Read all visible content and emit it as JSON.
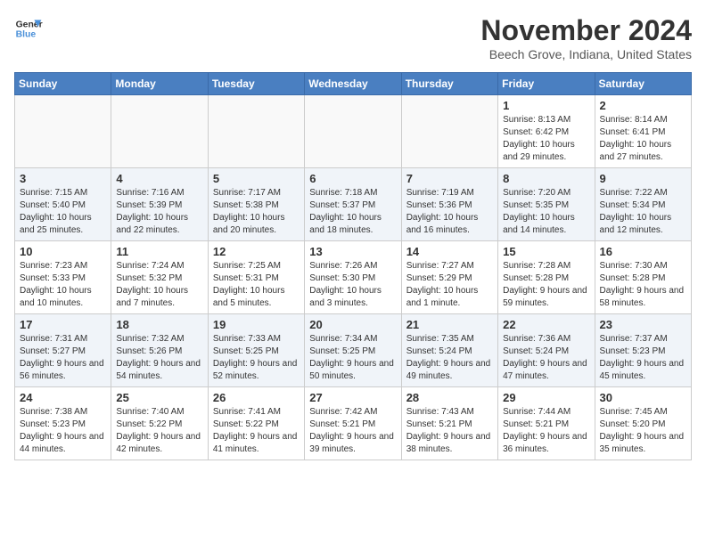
{
  "header": {
    "logo_line1": "General",
    "logo_line2": "Blue",
    "month": "November 2024",
    "location": "Beech Grove, Indiana, United States"
  },
  "weekdays": [
    "Sunday",
    "Monday",
    "Tuesday",
    "Wednesday",
    "Thursday",
    "Friday",
    "Saturday"
  ],
  "weeks": [
    [
      {
        "day": "",
        "info": ""
      },
      {
        "day": "",
        "info": ""
      },
      {
        "day": "",
        "info": ""
      },
      {
        "day": "",
        "info": ""
      },
      {
        "day": "",
        "info": ""
      },
      {
        "day": "1",
        "info": "Sunrise: 8:13 AM\nSunset: 6:42 PM\nDaylight: 10 hours and 29 minutes."
      },
      {
        "day": "2",
        "info": "Sunrise: 8:14 AM\nSunset: 6:41 PM\nDaylight: 10 hours and 27 minutes."
      }
    ],
    [
      {
        "day": "3",
        "info": "Sunrise: 7:15 AM\nSunset: 5:40 PM\nDaylight: 10 hours and 25 minutes."
      },
      {
        "day": "4",
        "info": "Sunrise: 7:16 AM\nSunset: 5:39 PM\nDaylight: 10 hours and 22 minutes."
      },
      {
        "day": "5",
        "info": "Sunrise: 7:17 AM\nSunset: 5:38 PM\nDaylight: 10 hours and 20 minutes."
      },
      {
        "day": "6",
        "info": "Sunrise: 7:18 AM\nSunset: 5:37 PM\nDaylight: 10 hours and 18 minutes."
      },
      {
        "day": "7",
        "info": "Sunrise: 7:19 AM\nSunset: 5:36 PM\nDaylight: 10 hours and 16 minutes."
      },
      {
        "day": "8",
        "info": "Sunrise: 7:20 AM\nSunset: 5:35 PM\nDaylight: 10 hours and 14 minutes."
      },
      {
        "day": "9",
        "info": "Sunrise: 7:22 AM\nSunset: 5:34 PM\nDaylight: 10 hours and 12 minutes."
      }
    ],
    [
      {
        "day": "10",
        "info": "Sunrise: 7:23 AM\nSunset: 5:33 PM\nDaylight: 10 hours and 10 minutes."
      },
      {
        "day": "11",
        "info": "Sunrise: 7:24 AM\nSunset: 5:32 PM\nDaylight: 10 hours and 7 minutes."
      },
      {
        "day": "12",
        "info": "Sunrise: 7:25 AM\nSunset: 5:31 PM\nDaylight: 10 hours and 5 minutes."
      },
      {
        "day": "13",
        "info": "Sunrise: 7:26 AM\nSunset: 5:30 PM\nDaylight: 10 hours and 3 minutes."
      },
      {
        "day": "14",
        "info": "Sunrise: 7:27 AM\nSunset: 5:29 PM\nDaylight: 10 hours and 1 minute."
      },
      {
        "day": "15",
        "info": "Sunrise: 7:28 AM\nSunset: 5:28 PM\nDaylight: 9 hours and 59 minutes."
      },
      {
        "day": "16",
        "info": "Sunrise: 7:30 AM\nSunset: 5:28 PM\nDaylight: 9 hours and 58 minutes."
      }
    ],
    [
      {
        "day": "17",
        "info": "Sunrise: 7:31 AM\nSunset: 5:27 PM\nDaylight: 9 hours and 56 minutes."
      },
      {
        "day": "18",
        "info": "Sunrise: 7:32 AM\nSunset: 5:26 PM\nDaylight: 9 hours and 54 minutes."
      },
      {
        "day": "19",
        "info": "Sunrise: 7:33 AM\nSunset: 5:25 PM\nDaylight: 9 hours and 52 minutes."
      },
      {
        "day": "20",
        "info": "Sunrise: 7:34 AM\nSunset: 5:25 PM\nDaylight: 9 hours and 50 minutes."
      },
      {
        "day": "21",
        "info": "Sunrise: 7:35 AM\nSunset: 5:24 PM\nDaylight: 9 hours and 49 minutes."
      },
      {
        "day": "22",
        "info": "Sunrise: 7:36 AM\nSunset: 5:24 PM\nDaylight: 9 hours and 47 minutes."
      },
      {
        "day": "23",
        "info": "Sunrise: 7:37 AM\nSunset: 5:23 PM\nDaylight: 9 hours and 45 minutes."
      }
    ],
    [
      {
        "day": "24",
        "info": "Sunrise: 7:38 AM\nSunset: 5:23 PM\nDaylight: 9 hours and 44 minutes."
      },
      {
        "day": "25",
        "info": "Sunrise: 7:40 AM\nSunset: 5:22 PM\nDaylight: 9 hours and 42 minutes."
      },
      {
        "day": "26",
        "info": "Sunrise: 7:41 AM\nSunset: 5:22 PM\nDaylight: 9 hours and 41 minutes."
      },
      {
        "day": "27",
        "info": "Sunrise: 7:42 AM\nSunset: 5:21 PM\nDaylight: 9 hours and 39 minutes."
      },
      {
        "day": "28",
        "info": "Sunrise: 7:43 AM\nSunset: 5:21 PM\nDaylight: 9 hours and 38 minutes."
      },
      {
        "day": "29",
        "info": "Sunrise: 7:44 AM\nSunset: 5:21 PM\nDaylight: 9 hours and 36 minutes."
      },
      {
        "day": "30",
        "info": "Sunrise: 7:45 AM\nSunset: 5:20 PM\nDaylight: 9 hours and 35 minutes."
      }
    ]
  ]
}
